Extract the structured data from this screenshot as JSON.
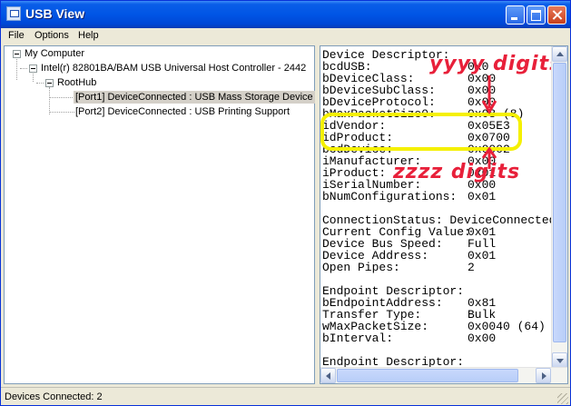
{
  "window": {
    "title": "USB View"
  },
  "menu": [
    "File",
    "Options",
    "Help"
  ],
  "tree": {
    "root": "My Computer",
    "controller": "Intel(r) 82801BA/BAM USB Universal Host Controller - 2442",
    "hub": "RootHub",
    "port1": "[Port1] DeviceConnected :  USB Mass Storage Device",
    "port2": "[Port2] DeviceConnected :  USB Printing Support"
  },
  "details": [
    {
      "label": "Device Descriptor:",
      "value": ""
    },
    {
      "label": "bcdUSB:",
      "value": "0x0"
    },
    {
      "label": "bDeviceClass:",
      "value": "0x00"
    },
    {
      "label": "bDeviceSubClass:",
      "value": "0x00"
    },
    {
      "label": "bDeviceProtocol:",
      "value": "0x00"
    },
    {
      "label": "bMaxPacketSize0:",
      "value": "0x08 (8)"
    },
    {
      "label": "idVendor:",
      "value": "0x05E3"
    },
    {
      "label": "idProduct:",
      "value": "0x0700"
    },
    {
      "label": "bcdDevice:",
      "value": "0x0002"
    },
    {
      "label": "iManufacturer:",
      "value": "0x00"
    },
    {
      "label": "iProduct:",
      "value": "0x01"
    },
    {
      "label": "iSerialNumber:",
      "value": "0x00"
    },
    {
      "label": "bNumConfigurations:",
      "value": "0x01"
    },
    {
      "label": "",
      "value": ""
    },
    {
      "label": "ConnectionStatus: DeviceConnected",
      "value": ""
    },
    {
      "label": "Current Config Value:",
      "value": "0x01"
    },
    {
      "label": "Device Bus Speed:",
      "value": "Full"
    },
    {
      "label": "Device Address:",
      "value": "0x01"
    },
    {
      "label": "Open Pipes:",
      "value": "2"
    },
    {
      "label": "",
      "value": ""
    },
    {
      "label": "Endpoint Descriptor:",
      "value": ""
    },
    {
      "label": "bEndpointAddress:",
      "value": "0x81"
    },
    {
      "label": "Transfer Type:",
      "value": "Bulk"
    },
    {
      "label": "wMaxPacketSize:",
      "value": "0x0040 (64)"
    },
    {
      "label": "bInterval:",
      "value": "0x00"
    },
    {
      "label": "",
      "value": ""
    },
    {
      "label": "Endpoint Descriptor:",
      "value": ""
    }
  ],
  "annotations": {
    "vendor": "yyyy digits",
    "product": "zzzz digits",
    "color": "#e8203a",
    "highlight": "#f5f000"
  },
  "status": "Devices Connected: 2"
}
